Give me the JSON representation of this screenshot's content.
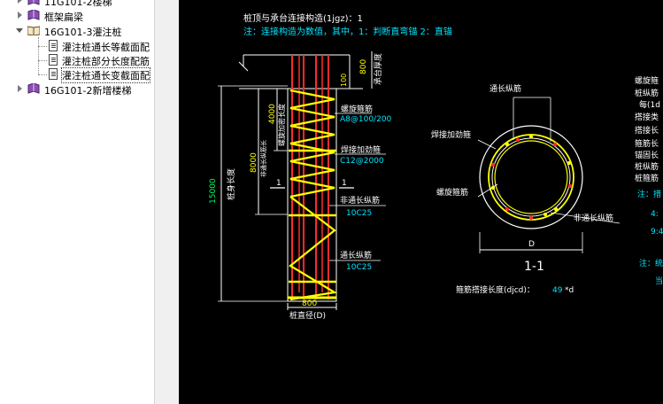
{
  "tree": {
    "items": [
      {
        "label": "11G101-2楼梯",
        "expanded": false
      },
      {
        "label": "框架扁梁",
        "expanded": false
      },
      {
        "label": "16G101-3灌注桩",
        "expanded": true
      },
      {
        "label": "灌注桩通长等截面配",
        "expanded": false
      },
      {
        "label": "灌注桩部分长度配筋",
        "expanded": false
      },
      {
        "label": "灌注桩通长变截面配",
        "expanded": false
      },
      {
        "label": "16G101-2新增楼梯",
        "expanded": false
      }
    ]
  },
  "drawing": {
    "title1": "桩顶与承台连接构造(1jgz)：1",
    "title2": "注：连接构造为数值，其中，1：判断直弯锚      2：直锚",
    "dim_800_top": "800",
    "dim_100": "100",
    "label_cap": "承台厚度",
    "dim_4000": "4000",
    "label_spiral_dense": "螺旋加密长度",
    "dim_8000": "8000",
    "label_nonfull_len": "非通长纵筋长",
    "dim_15000": "15000",
    "label_pile_len": "桩身长度",
    "label_spiral": "螺旋箍筋",
    "val_spiral": "A8@100/200",
    "label_ring": "焊接加劲箍",
    "val_ring": "C12@2000",
    "section_mark": "1",
    "label_nonfull": "非通长纵筋",
    "val_nonfull": "10C25",
    "label_full": "通长纵筋",
    "val_full": "10C25",
    "dim_800_bottom": "800",
    "label_diameter": "桩直径(D)",
    "sec_full": "通长纵筋",
    "sec_ring": "焊接加劲箍",
    "sec_spiral": "螺旋箍筋",
    "sec_nonfull": "非通长纵筋",
    "sec_D": "D",
    "sec_title": "1-1",
    "lap_label": "箍筋搭接长度(djcd)：",
    "lap_value": "49",
    "lap_unit": "*d",
    "right_notes": [
      "螺旋箍",
      "桩纵筋",
      "每(1d",
      "搭接类",
      "搭接长",
      "箍筋长",
      "锚固长",
      "桩纵筋",
      "桩箍筋"
    ],
    "right_note_a": "注：措",
    "right_note_b": "4:",
    "right_note_c": "9:4",
    "right_note_d": "注：统",
    "right_note_e": "当"
  }
}
